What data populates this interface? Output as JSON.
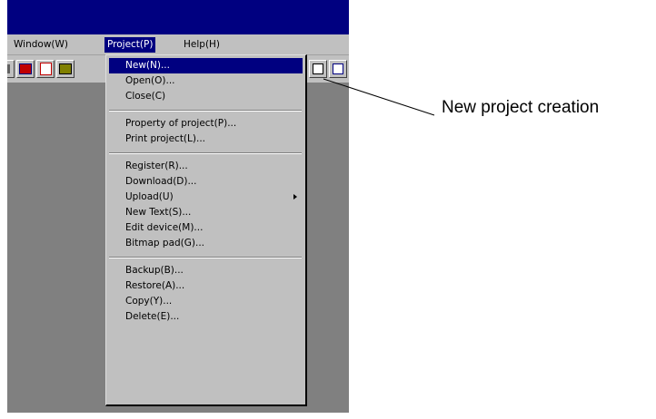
{
  "menubar": {
    "items": [
      {
        "label": "Window(W)"
      },
      {
        "label": "Project(P)",
        "active": true
      },
      {
        "label": "Help(H)"
      }
    ]
  },
  "toolbar": {
    "buttons": [
      "tool-icon",
      "tool-icon",
      "tool-icon",
      "tool-icon",
      "tool-icon",
      "tool-icon"
    ]
  },
  "project_menu": {
    "items": [
      {
        "label": "New(N)...",
        "highlighted": true
      },
      {
        "label": "Open(O)..."
      },
      {
        "label": "Close(C)"
      },
      {
        "label": "Property of project(P)..."
      },
      {
        "label": "Print project(L)..."
      },
      {
        "label": "Register(R)..."
      },
      {
        "label": "Download(D)..."
      },
      {
        "label": "Upload(U)",
        "submenu": true
      },
      {
        "label": "New Text(S)..."
      },
      {
        "label": "Edit device(M)..."
      },
      {
        "label": "Bitmap pad(G)..."
      },
      {
        "label": "Backup(B)..."
      },
      {
        "label": "Restore(A)..."
      },
      {
        "label": "Copy(Y)..."
      },
      {
        "label": "Delete(E)..."
      }
    ]
  },
  "callout": {
    "label": "New project creation"
  },
  "colors": {
    "titlebar": "#000080",
    "face": "#c0c0c0",
    "workspace": "#808080",
    "highlight": "#000080"
  }
}
